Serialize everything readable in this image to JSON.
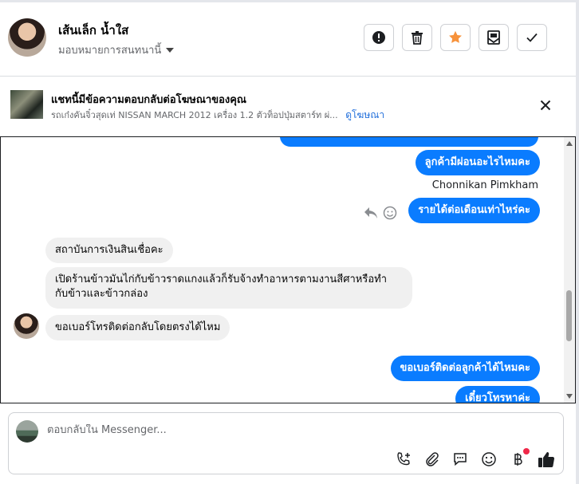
{
  "header": {
    "contact_name": "เส้นเล็ก น้ำใส",
    "assign_label": "มอบหมายการสนทนานี้"
  },
  "ad": {
    "title": "แชทนี้มีข้อความตอบกลับต่อโฆษณาของคุณ",
    "subtitle": "รถเก๋งคันจิ๋วสุดเท่ NISSAN MARCH 2012 เครื่อง 1.2 ตัวท็อปปุ่มสตาร์ท ผ่...",
    "link": "ดูโฆษณา"
  },
  "messages": {
    "out1": "ลูกค้ามีผ่อนอะไรไหมคะ",
    "sender": "Chonnikan Pimkham",
    "out2": "รายได้ต่อเดือนเท่าไหร่คะ",
    "in1": "สถาบันการเงินสินเชื่อคะ",
    "in2_line1": "เปิดร้านข้าวมันไก่กับข้าวราดแกงแล้วก็รับจ้างทำอาหารตามงานสีศาหรือทำ",
    "in2_line2": "กับข้าวและข้าวกล่อง",
    "in3": "ขอเบอร์โทรติดต่อกลับโดยตรงได้ไหม",
    "out3": "ขอเบอร์ติดต่อลูกค้าได้ไหมคะ",
    "out4": "เดี๋ยวโทรหาค่ะ"
  },
  "composer": {
    "placeholder": "ตอบกลับใน Messenger..."
  },
  "colors": {
    "accent": "#0a7cff",
    "star": "#f7923b",
    "link": "#216fdb",
    "notification_dot": "#f02849"
  }
}
